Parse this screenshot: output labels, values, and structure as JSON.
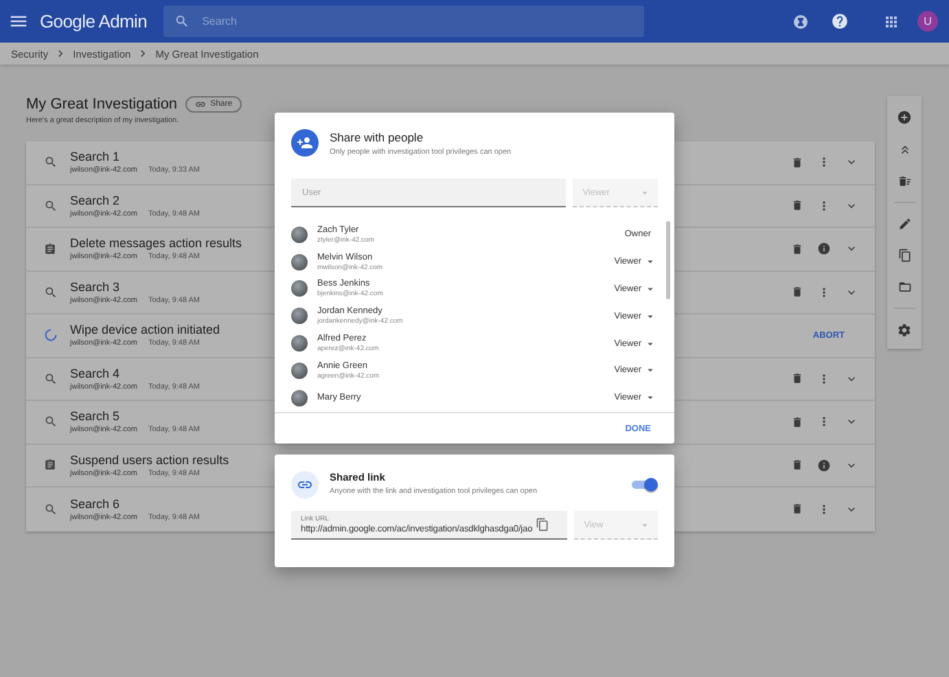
{
  "app_bar": {
    "product": "Google Admin",
    "search": {
      "placeholder": "Search"
    },
    "avatar": "U"
  },
  "breadcrumbs": [
    "Security",
    "Investigation",
    "My Great Investigation"
  ],
  "investigation": {
    "title": "My Great Investigation",
    "share_button": "Share",
    "description": "Here's a great description of my investigation."
  },
  "items": [
    {
      "kind": "search",
      "title": "Search 1",
      "user": "jwilson@ink-42.com",
      "time": "Today, 9:33 AM"
    },
    {
      "kind": "search",
      "title": "Search 2",
      "user": "jwilson@ink-42.com",
      "time": "Today, 9:48 AM"
    },
    {
      "kind": "report",
      "title": "Delete messages action results",
      "user": "jwilson@ink-42.com",
      "time": "Today, 9:48 AM"
    },
    {
      "kind": "search",
      "title": "Search 3",
      "user": "jwilson@ink-42.com",
      "time": "Today, 9:48 AM"
    },
    {
      "kind": "pending",
      "title": "Wipe device action initiated",
      "user": "jwilson@ink-42.com",
      "time": "Today, 9:48 AM",
      "action_label": "ABORT"
    },
    {
      "kind": "search",
      "title": "Search 4",
      "user": "jwilson@ink-42.com",
      "time": "Today, 9:48 AM"
    },
    {
      "kind": "search",
      "title": "Search 5",
      "user": "jwilson@ink-42.com",
      "time": "Today, 9:48 AM"
    },
    {
      "kind": "report",
      "title": "Suspend users action results",
      "user": "jwilson@ink-42.com",
      "time": "Today, 9:48 AM"
    },
    {
      "kind": "search",
      "title": "Search 6",
      "user": "jwilson@ink-42.com",
      "time": "Today, 9:48 AM"
    }
  ],
  "share_dialog": {
    "title": "Share with people",
    "subtitle": "Only people with investigation tool privileges can open",
    "user_field": {
      "placeholder": "User"
    },
    "role_select": {
      "placeholder": "Viewer",
      "disabled": true
    },
    "people": [
      {
        "name": "Zach Tyler",
        "email": "ztyler@ink-42.com",
        "role": "Owner",
        "editable": false
      },
      {
        "name": "Melvin Wilson",
        "email": "mwilson@ink-42.com",
        "role": "Viewer",
        "editable": true
      },
      {
        "name": "Bess Jenkins",
        "email": "bjenkins@ink-42.com",
        "role": "Viewer",
        "editable": true
      },
      {
        "name": "Jordan Kennedy",
        "email": "jordankennedy@ink-42.com",
        "role": "Viewer",
        "editable": true
      },
      {
        "name": "Alfred Perez",
        "email": "aperez@ink-42.com",
        "role": "Viewer",
        "editable": true
      },
      {
        "name": "Annie Green",
        "email": "agreen@ink-42.com",
        "role": "Viewer",
        "editable": true
      },
      {
        "name": "Mary Berry",
        "role": "Viewer",
        "editable": true
      }
    ],
    "done": "DONE"
  },
  "link_dialog": {
    "title": "Shared link",
    "subtitle": "Anyone with the link and investigation tool privileges can open",
    "on": true,
    "url_field": {
      "label": "Link URL",
      "value": "http://admin.google.com/ac/investigation/asdklghasdga0/jao"
    },
    "access_select": {
      "placeholder": "View",
      "disabled": true
    }
  }
}
